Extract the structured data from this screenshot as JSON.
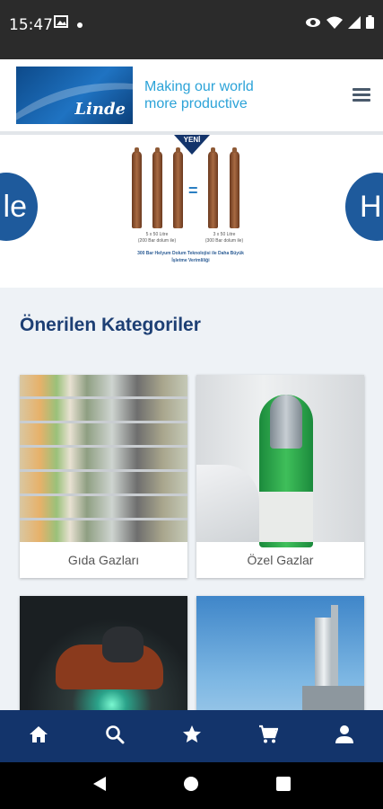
{
  "status_bar": {
    "time": "15:47",
    "icons": [
      "image-icon",
      "dot-icon",
      "eye-icon",
      "wifi-icon",
      "signal-icon",
      "battery-icon"
    ]
  },
  "header": {
    "logo_text": "Linde",
    "tagline_line1": "Making our world",
    "tagline_line2": "more productive",
    "menu_icon": "hamburger-menu-icon"
  },
  "banner": {
    "badge": "YENİ",
    "left_bubble_text": "le",
    "right_bubble_text": "H",
    "caption_left_1": "5 x 50 Litre",
    "caption_left_2": "(200 Bar dolum ile)",
    "caption_right_1": "3 x 50 Litre",
    "caption_right_2": "(300 Bar dolum ile)",
    "description": "300 Bar Helyum Dolum Teknolojisi ile Daha Büyük İşletme Verimliliği"
  },
  "categories": {
    "title": "Önerilen Kategoriler",
    "items": [
      {
        "label": "Gıda Gazları"
      },
      {
        "label": "Özel Gazlar"
      },
      {
        "label": ""
      },
      {
        "label": ""
      }
    ]
  },
  "bottom_nav": {
    "items": [
      "home-icon",
      "search-icon",
      "star-icon",
      "cart-icon",
      "profile-icon"
    ]
  },
  "colors": {
    "brand_dark": "#13346b",
    "brand_light": "#2ca3d8"
  }
}
